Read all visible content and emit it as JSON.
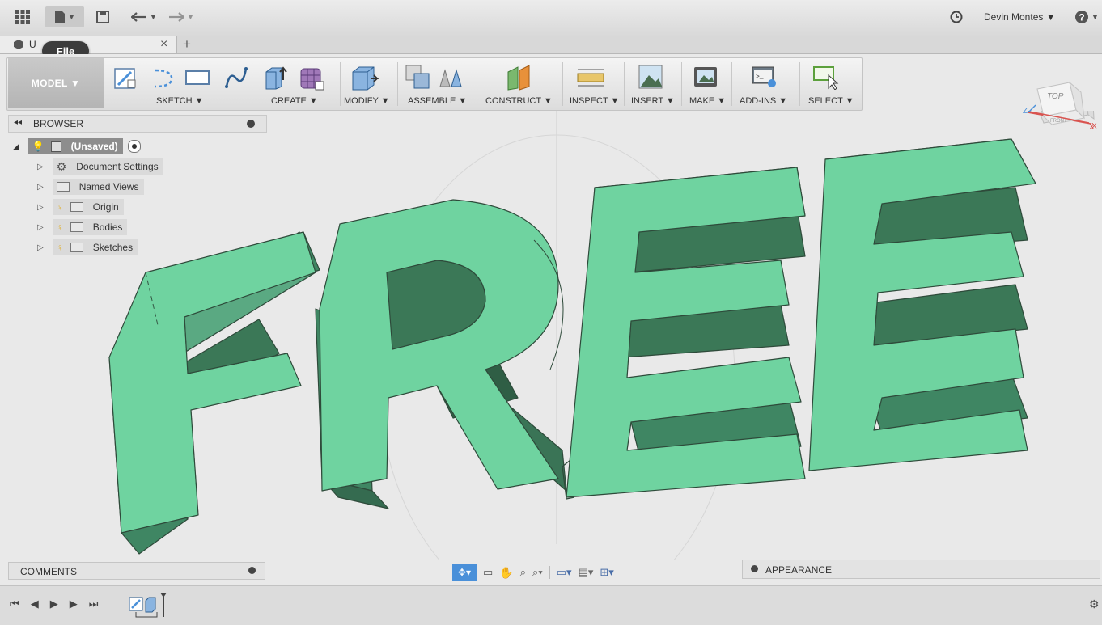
{
  "topbar": {
    "user_name": "Devin Montes ▼",
    "icons": [
      "grid-icon",
      "file-icon",
      "save-icon",
      "undo-icon",
      "redo-icon",
      "clock-icon",
      "help-icon"
    ]
  },
  "tabs": {
    "doc_tab_prefix": "U",
    "close": "×",
    "add": "+",
    "tooltip": "File"
  },
  "toolbar": {
    "model": "MODEL ▼",
    "sketch": "SKETCH ▼",
    "create": "CREATE ▼",
    "modify": "MODIFY ▼",
    "assemble": "ASSEMBLE ▼",
    "construct": "CONSTRUCT ▼",
    "inspect": "INSPECT ▼",
    "insert": "INSERT ▼",
    "make": "MAKE ▼",
    "addins": "ADD-INS ▼",
    "select": "SELECT ▼"
  },
  "browser": {
    "header": "BROWSER",
    "collapse": "◂◂",
    "root": "(Unsaved)",
    "items": [
      {
        "label": "Document Settings",
        "icon": "gear-icon"
      },
      {
        "label": "Named Views",
        "icon": "folder-icon"
      },
      {
        "label": "Origin",
        "icon": "folder-icon"
      },
      {
        "label": "Bodies",
        "icon": "folder-icon"
      },
      {
        "label": "Sketches",
        "icon": "folder-icon"
      }
    ]
  },
  "viewcube": {
    "top": "TOP",
    "front": "FRONT",
    "x": "X",
    "z": "Z"
  },
  "viewport": {
    "model_text": "FREE",
    "body_color": "#6fd3a0"
  },
  "comments": {
    "label": "COMMENTS"
  },
  "appearance": {
    "label": "APPEARANCE"
  },
  "colors": {
    "accent_blue": "#4a90d9",
    "body_green": "#6fd3a0"
  }
}
